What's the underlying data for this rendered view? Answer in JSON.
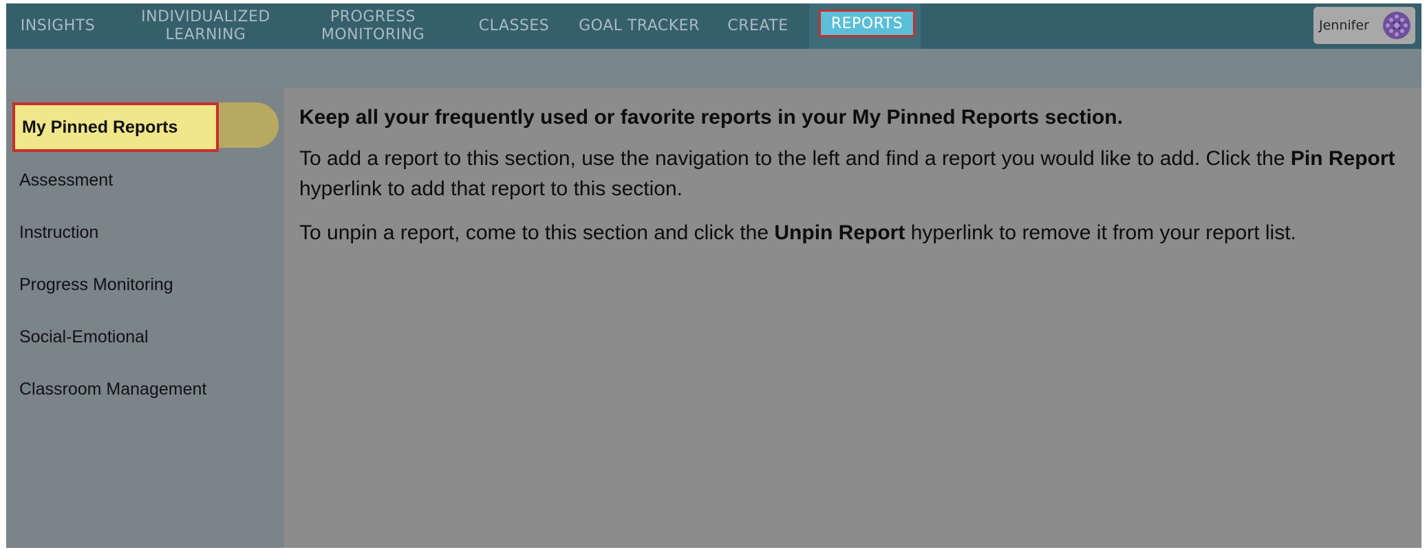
{
  "topnav": {
    "items": [
      {
        "label": "INSIGHTS"
      },
      {
        "label": "INDIVIDUALIZED\nLEARNING"
      },
      {
        "label": "PROGRESS\nMONITORING"
      },
      {
        "label": "CLASSES"
      },
      {
        "label": "GOAL TRACKER"
      },
      {
        "label": "CREATE"
      },
      {
        "label": "REPORTS",
        "active": true
      }
    ],
    "user": {
      "name": "Jennifer",
      "avatar_icon": "avatar-pattern-icon"
    }
  },
  "sidebar": {
    "items": [
      {
        "label": "My Pinned Reports",
        "selected": true
      },
      {
        "label": "Assessment"
      },
      {
        "label": "Instruction"
      },
      {
        "label": "Progress Monitoring"
      },
      {
        "label": "Social-Emotional"
      },
      {
        "label": "Classroom Management"
      }
    ]
  },
  "content": {
    "heading": "Keep all your frequently used or favorite reports in your My Pinned Reports section.",
    "para1_before": "To add a report to this section, use the navigation to the left and find a report you would like to add. Click the ",
    "para1_bold": "Pin Report",
    "para1_after": " hyperlink to add that report to this section.",
    "para2_before": "To unpin a report, come to this section and click the ",
    "para2_bold": "Unpin Report",
    "para2_after": " hyperlink to remove it from your report list."
  },
  "colors": {
    "nav_bg": "#365f6c",
    "active_tab": "#5bbfd9",
    "highlight_border": "#c8302b",
    "selected_item_bg": "#f0e68a"
  }
}
